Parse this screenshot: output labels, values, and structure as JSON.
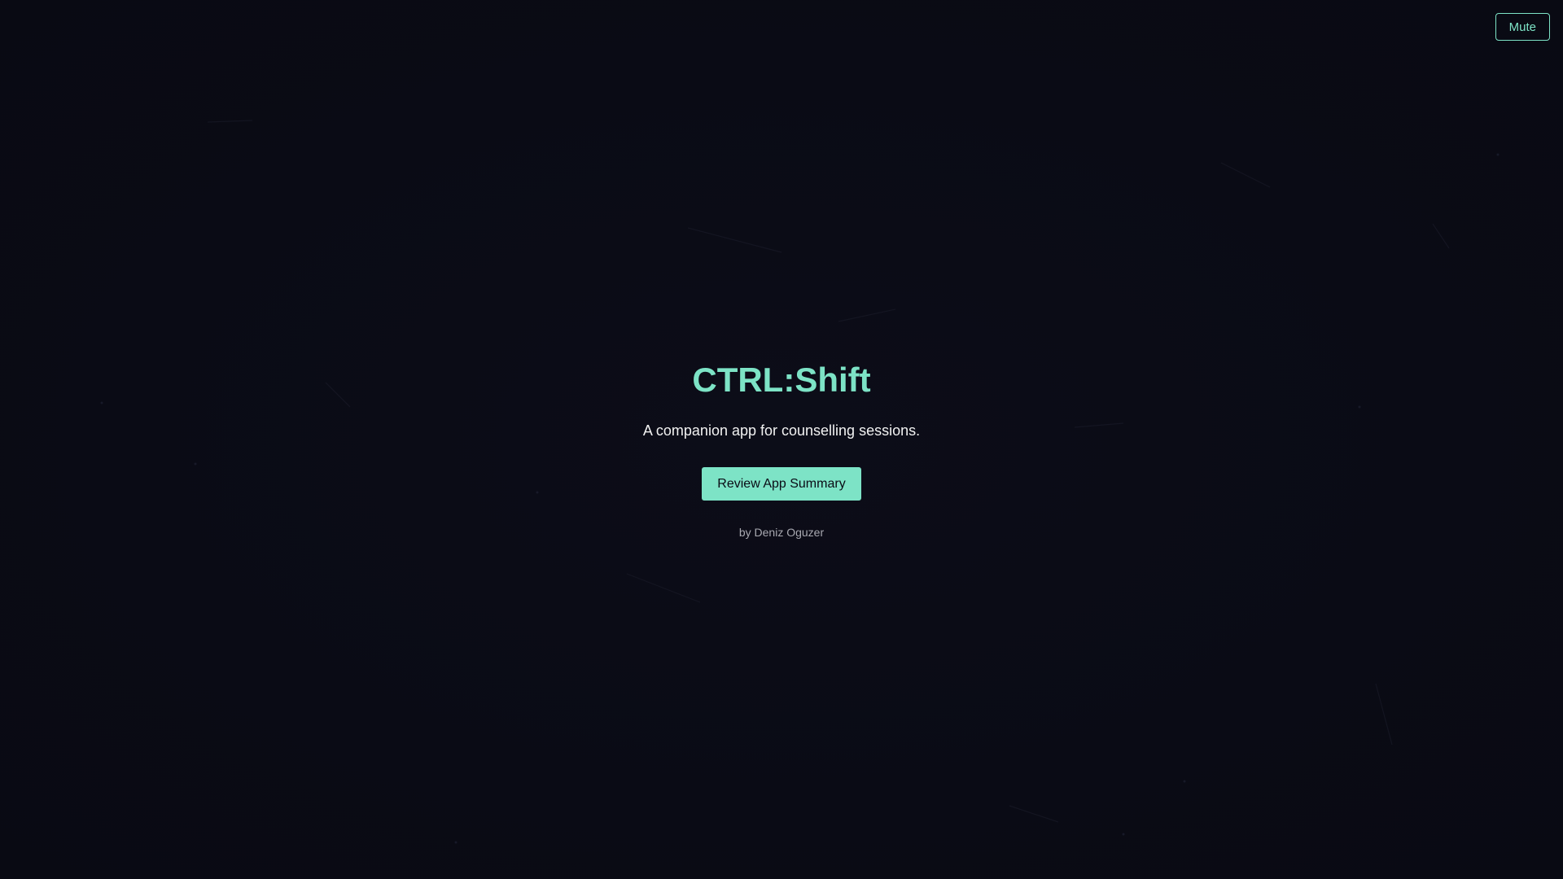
{
  "header": {
    "mute_label": "Mute"
  },
  "hero": {
    "title": "CTRL:Shift",
    "subtitle": "A companion app for counselling sessions.",
    "cta_label": "Review App Summary",
    "author": "by Deniz Oguzer"
  },
  "colors": {
    "background": "#0a0b15",
    "accent": "#7de3c6",
    "text": "#f2f2f2",
    "muted_text": "#a8a8b0"
  }
}
